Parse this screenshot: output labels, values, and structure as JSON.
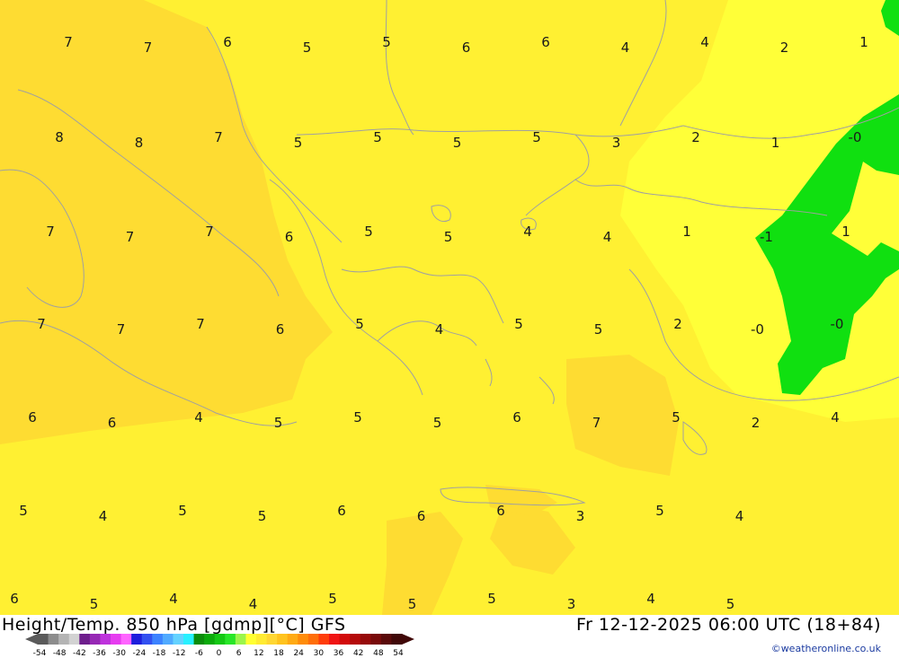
{
  "title": "Height/Temp. 850 hPa [gdmp][°C] GFS",
  "valid_time": "Fr 12-12-2025 06:00 UTC (18+84)",
  "credit": "©weatheronline.co.uk",
  "colors": {
    "warm_orange": "#fedc32",
    "yellow": "#fff032",
    "light_yellow": "#ffff38",
    "green": "#10e010",
    "coast": "#a0a0a0"
  },
  "legend_ticks": [
    "-54",
    "-48",
    "-42",
    "-36",
    "-30",
    "-24",
    "-18",
    "-12",
    "-6",
    "0",
    "6",
    "12",
    "18",
    "24",
    "30",
    "36",
    "42",
    "48",
    "54"
  ],
  "legend_colors": [
    "#5a5a5a",
    "#8c8c8c",
    "#b4b4b4",
    "#d2d2d2",
    "#6e1e8c",
    "#9628b4",
    "#be32dc",
    "#e63cf0",
    "#ff64ff",
    "#1e1edc",
    "#3250f0",
    "#3c82ff",
    "#50aaff",
    "#64d2ff",
    "#28f0ff",
    "#0a8c0a",
    "#0aaa0a",
    "#14c814",
    "#28e628",
    "#9bf54b",
    "#ffff32",
    "#ffeb32",
    "#ffd732",
    "#ffc31e",
    "#ffaa14",
    "#ff8c0a",
    "#ff6e0a",
    "#ff3c0a",
    "#f01414",
    "#d20a0a",
    "#b40a0a",
    "#960a0a",
    "#780a0a",
    "#5a0a0a",
    "#400808"
  ],
  "grid_values": [
    [
      "7",
      "7",
      "6",
      "5",
      "5",
      "6",
      "6",
      "4",
      "4",
      "2",
      "1"
    ],
    [
      "8",
      "8",
      "7",
      "5",
      "5",
      "5",
      "5",
      "3",
      "2",
      "1",
      "-0"
    ],
    [
      "7",
      "7",
      "7",
      "6",
      "5",
      "5",
      "4",
      "4",
      "1",
      "-1",
      "1"
    ],
    [
      "7",
      "7",
      "7",
      "6",
      "5",
      "4",
      "5",
      "5",
      "2",
      "-0",
      "-0"
    ],
    [
      "6",
      "6",
      "4",
      "5",
      "5",
      "5",
      "6",
      "7",
      "5",
      "2",
      "4"
    ],
    [
      "5",
      "4",
      "5",
      "5",
      "6",
      "6",
      "6",
      "3",
      "5",
      "4"
    ],
    [
      "6",
      "5",
      "4",
      "4",
      "5",
      "5",
      "5",
      "3",
      "4",
      "5"
    ]
  ]
}
